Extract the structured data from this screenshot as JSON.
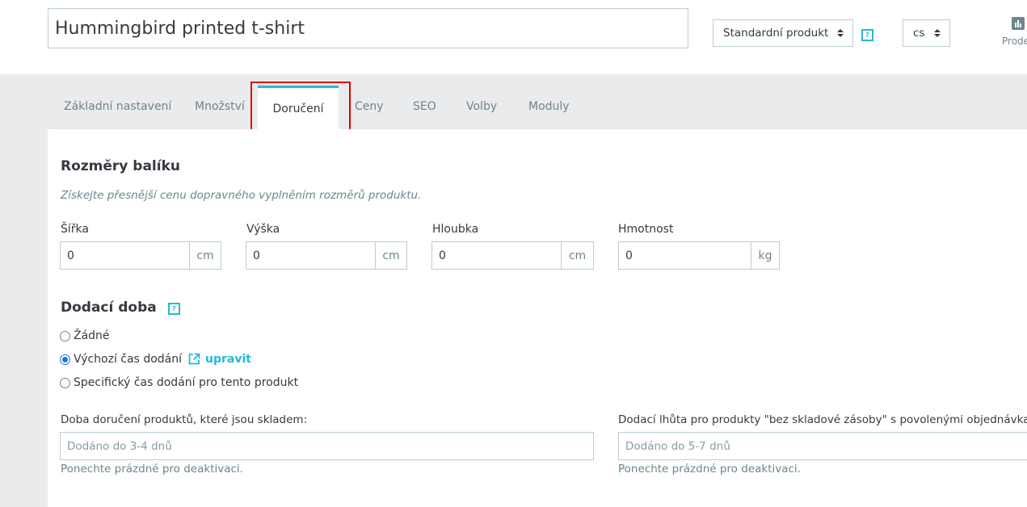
{
  "header": {
    "product_name": "Hummingbird printed t-shirt",
    "product_type": "Standardní produkt",
    "language": "cs",
    "stats_label": "Prodej"
  },
  "tabs": [
    {
      "label": "Základní nastavení"
    },
    {
      "label": "Množství"
    },
    {
      "label": "Doručení",
      "active": true
    },
    {
      "label": "Ceny"
    },
    {
      "label": "SEO"
    },
    {
      "label": "Volby"
    },
    {
      "label": "Moduly"
    }
  ],
  "package": {
    "title": "Rozměry balíku",
    "subtitle": "Získejte přesnější cenu dopravného vyplněním rozměrů produktu.",
    "fields": [
      {
        "label": "Šířka",
        "value": "0",
        "unit": "cm"
      },
      {
        "label": "Výška",
        "value": "0",
        "unit": "cm"
      },
      {
        "label": "Hloubka",
        "value": "0",
        "unit": "cm"
      },
      {
        "label": "Hmotnost",
        "value": "0",
        "unit": "kg"
      }
    ]
  },
  "delivery": {
    "title": "Dodací doba",
    "options": [
      {
        "label": "Žádné",
        "checked": false
      },
      {
        "label": "Výchozí čas dodání",
        "checked": true
      },
      {
        "label": "Specifický čas dodání pro tento produkt",
        "checked": false
      }
    ],
    "edit_link": "upravit",
    "in_stock_label": "Doba doručení produktů, které jsou skladem:",
    "in_stock_placeholder": "Dodáno do 3-4 dnů",
    "out_of_stock_label": "Dodací lhůta pro produkty \"bez skladové zásoby\" s povolenými objednávkami:",
    "out_of_stock_placeholder": "Dodáno do 5-7 dnů",
    "hint": "Ponechte prázdné pro deaktivaci."
  },
  "colors": {
    "accent": "#25b9d7",
    "highlight": "#e00000",
    "tab_bar": "#eaebec"
  },
  "icons": {
    "help": "help-icon",
    "stats": "bar-chart-icon",
    "external": "external-link-icon"
  }
}
